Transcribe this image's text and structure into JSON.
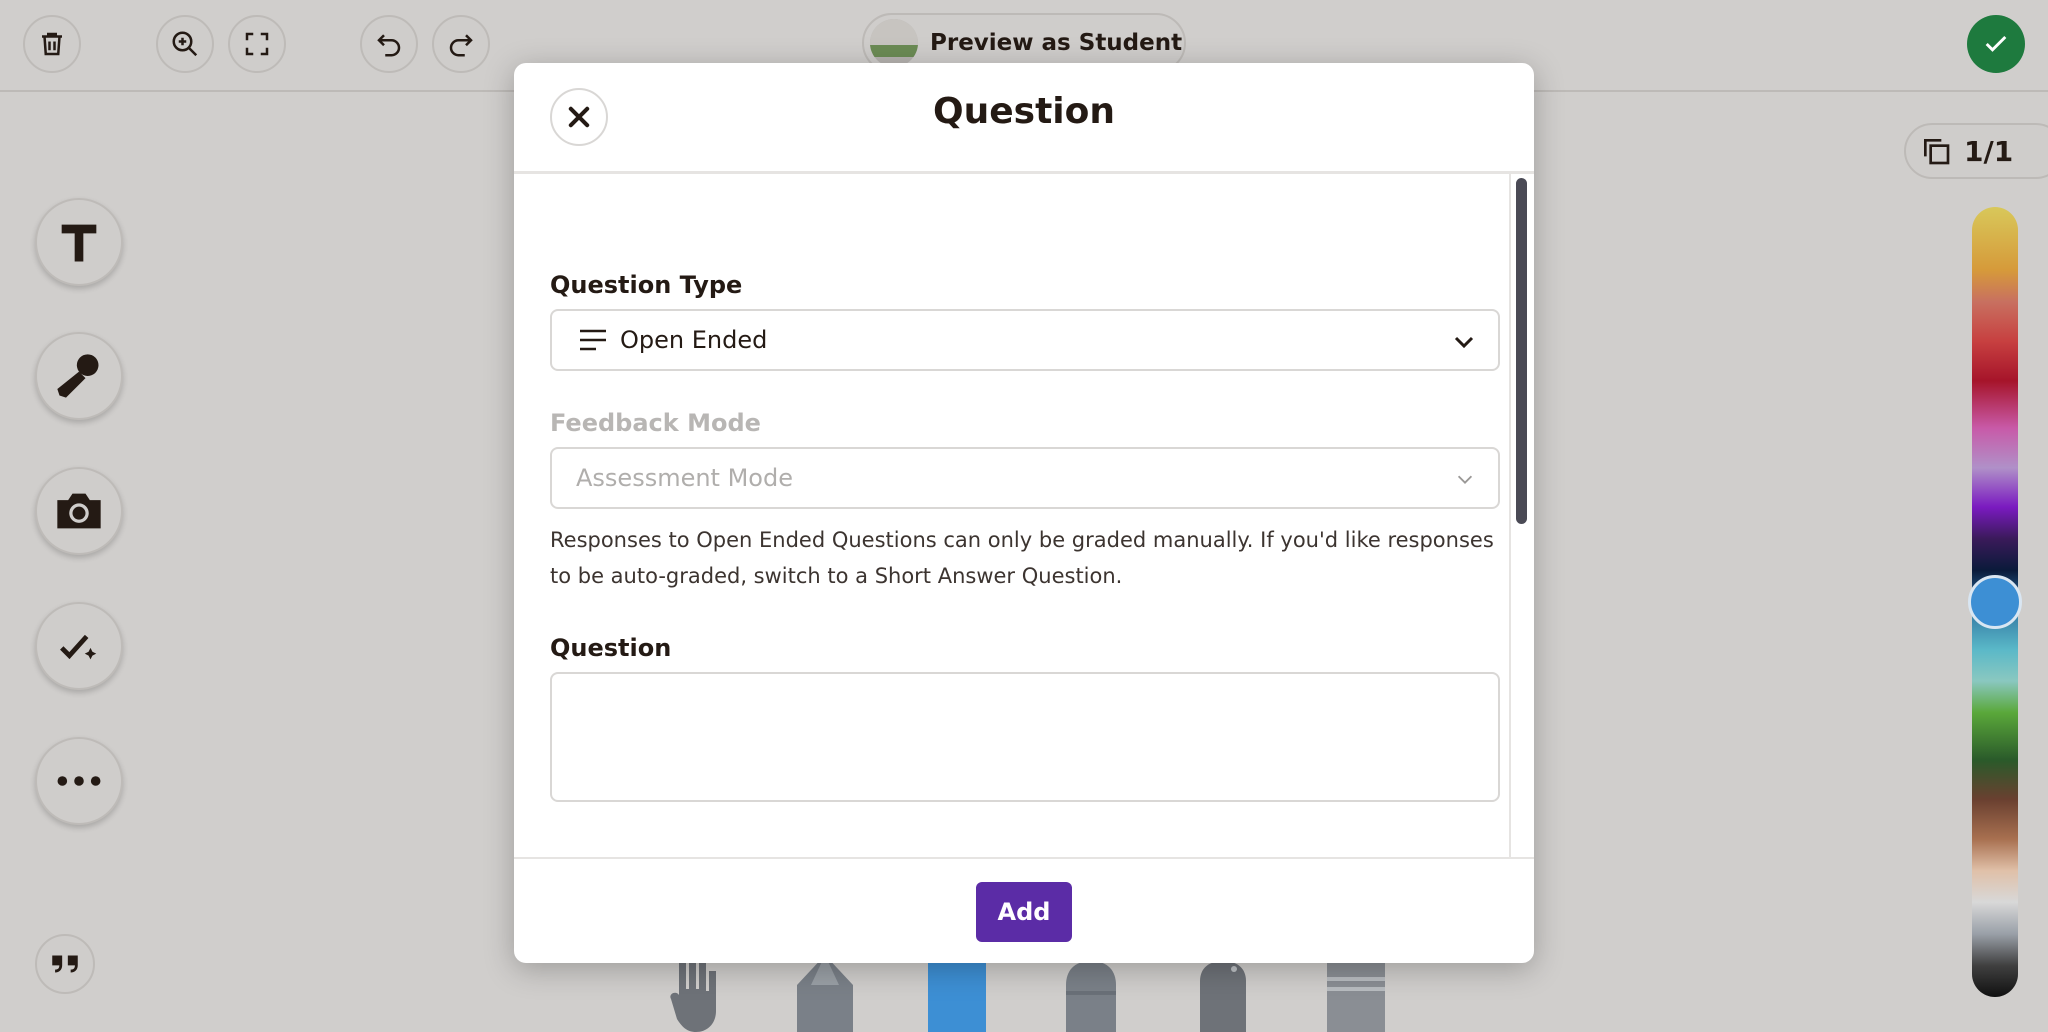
{
  "toolbar": {
    "preview_label": "Preview as Student",
    "page_counter": "1/1"
  },
  "modal": {
    "title": "Question",
    "question_type": {
      "label": "Question Type",
      "value": "Open Ended"
    },
    "feedback_mode": {
      "label": "Feedback Mode",
      "value": "Assessment Mode",
      "disabled": true
    },
    "help_text": "Responses to Open Ended Questions can only be graded manually. If you'd like responses to be auto-graded, switch to a Short Answer Question.",
    "question": {
      "label": "Question",
      "value": ""
    },
    "add_label": "Add"
  },
  "colors": {
    "accent": "#5b2ca6",
    "done": "#1e7a3e",
    "selected_color": "#3d8fd4"
  },
  "icons": {
    "toolbar": [
      "trash-icon",
      "zoom-in-icon",
      "fullscreen-icon",
      "undo-icon",
      "redo-icon",
      "check-icon"
    ],
    "tools": [
      "text-icon",
      "microphone-icon",
      "camera-icon",
      "auto-check-icon",
      "more-icon",
      "quote-icon"
    ],
    "pens": [
      "hand-icon",
      "pencil-icon",
      "marker-icon",
      "highlighter-icon",
      "pen-icon",
      "eraser-icon"
    ]
  }
}
